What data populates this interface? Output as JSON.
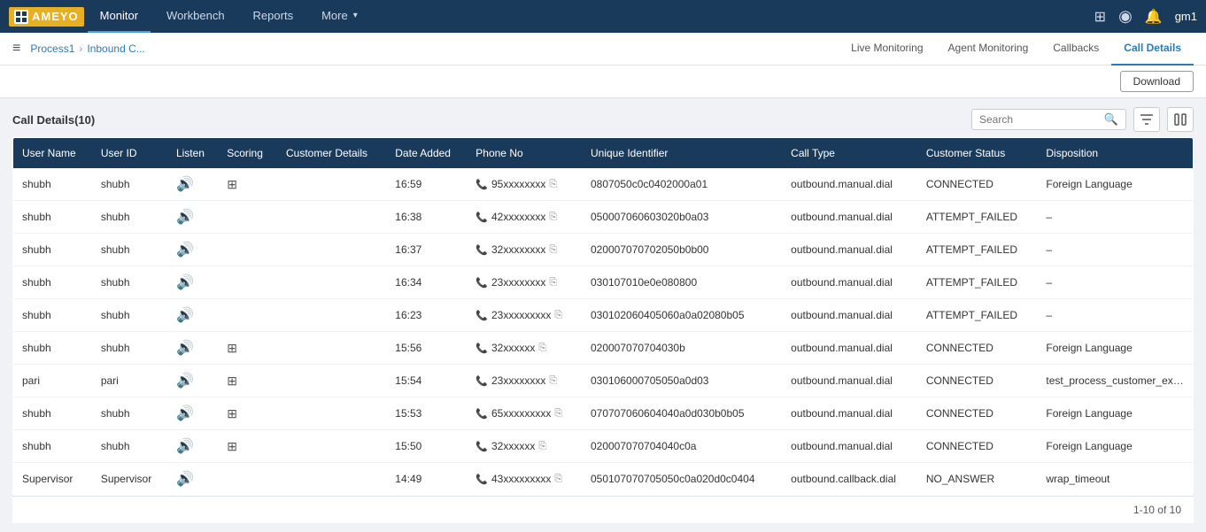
{
  "app": {
    "logo_text": "AMEYO"
  },
  "top_nav": {
    "items": [
      {
        "label": "Monitor",
        "active": true
      },
      {
        "label": "Workbench",
        "active": false
      },
      {
        "label": "Reports",
        "active": false
      },
      {
        "label": "More",
        "active": false,
        "has_arrow": true
      }
    ],
    "user": "gm1",
    "icons": [
      "grid-icon",
      "circle-icon",
      "bell-icon"
    ]
  },
  "breadcrumb": {
    "menu_icon": "≡",
    "home": "Process1",
    "separator": ">",
    "current": "Inbound C..."
  },
  "sub_nav": {
    "items": [
      {
        "label": "Live Monitoring",
        "active": false
      },
      {
        "label": "Agent Monitoring",
        "active": false
      },
      {
        "label": "Callbacks",
        "active": false
      },
      {
        "label": "Call Details",
        "active": true
      }
    ]
  },
  "download_btn": "Download",
  "table": {
    "title": "Call Details(10)",
    "search_placeholder": "Search",
    "columns": [
      "User Name",
      "User ID",
      "Listen",
      "Scoring",
      "Customer Details",
      "Date Added",
      "Phone No",
      "Unique Identifier",
      "Call Type",
      "Customer Status",
      "Disposition"
    ],
    "rows": [
      {
        "user_name": "shubh",
        "user_id": "shubh",
        "listen": true,
        "scoring": true,
        "customer_details": "",
        "date_added": "16:59",
        "phone_no": "95xxxxxxxx",
        "unique_id": "0807050c0c0402000a01",
        "call_type": "outbound.manual.dial",
        "status": "CONNECTED",
        "status_class": "status-connected",
        "disposition": "Foreign Language"
      },
      {
        "user_name": "shubh",
        "user_id": "shubh",
        "listen": true,
        "scoring": false,
        "customer_details": "",
        "date_added": "16:38",
        "phone_no": "42xxxxxxxx",
        "unique_id": "050007060603020b0a03",
        "call_type": "outbound.manual.dial",
        "status": "ATTEMPT_FAILED",
        "status_class": "status-attempt",
        "disposition": "–"
      },
      {
        "user_name": "shubh",
        "user_id": "shubh",
        "listen": true,
        "scoring": false,
        "customer_details": "",
        "date_added": "16:37",
        "phone_no": "32xxxxxxxx",
        "unique_id": "020007070702050b0b00",
        "call_type": "outbound.manual.dial",
        "status": "ATTEMPT_FAILED",
        "status_class": "status-attempt",
        "disposition": "–"
      },
      {
        "user_name": "shubh",
        "user_id": "shubh",
        "listen": true,
        "scoring": false,
        "customer_details": "",
        "date_added": "16:34",
        "phone_no": "23xxxxxxxx",
        "unique_id": "030107010e0e080800",
        "call_type": "outbound.manual.dial",
        "status": "ATTEMPT_FAILED",
        "status_class": "status-attempt",
        "disposition": "–"
      },
      {
        "user_name": "shubh",
        "user_id": "shubh",
        "listen": true,
        "scoring": false,
        "customer_details": "",
        "date_added": "16:23",
        "phone_no": "23xxxxxxxxx",
        "unique_id": "030102060405060a0a02080b05",
        "call_type": "outbound.manual.dial",
        "status": "ATTEMPT_FAILED",
        "status_class": "status-attempt",
        "disposition": "–"
      },
      {
        "user_name": "shubh",
        "user_id": "shubh",
        "listen": true,
        "scoring": true,
        "customer_details": "",
        "date_added": "15:56",
        "phone_no": "32xxxxxx",
        "unique_id": "020007070704030b",
        "call_type": "outbound.manual.dial",
        "status": "CONNECTED",
        "status_class": "status-connected",
        "disposition": "Foreign Language"
      },
      {
        "user_name": "pari",
        "user_id": "pari",
        "listen": true,
        "scoring": true,
        "customer_details": "",
        "date_added": "15:54",
        "phone_no": "23xxxxxxxx",
        "unique_id": "030106000705050a0d03",
        "call_type": "outbound.manual.dial",
        "status": "CONNECTED",
        "status_class": "status-connected",
        "disposition": "test_process_customer_exclusi..."
      },
      {
        "user_name": "shubh",
        "user_id": "shubh",
        "listen": true,
        "scoring": true,
        "customer_details": "",
        "date_added": "15:53",
        "phone_no": "65xxxxxxxxx",
        "unique_id": "070707060604040a0d030b0b05",
        "call_type": "outbound.manual.dial",
        "status": "CONNECTED",
        "status_class": "status-connected",
        "disposition": "Foreign Language"
      },
      {
        "user_name": "shubh",
        "user_id": "shubh",
        "listen": true,
        "scoring": true,
        "customer_details": "",
        "date_added": "15:50",
        "phone_no": "32xxxxxx",
        "unique_id": "020007070704040c0a",
        "call_type": "outbound.manual.dial",
        "status": "CONNECTED",
        "status_class": "status-connected",
        "disposition": "Foreign Language"
      },
      {
        "user_name": "Supervisor",
        "user_id": "Supervisor",
        "listen": true,
        "scoring": false,
        "customer_details": "",
        "date_added": "14:49",
        "phone_no": "43xxxxxxxxx",
        "unique_id": "050107070705050c0a020d0c0404",
        "call_type": "outbound.callback.dial",
        "status": "NO_ANSWER",
        "status_class": "status-no-answer",
        "disposition": "wrap_timeout"
      }
    ],
    "pagination": "1-10 of 10"
  }
}
